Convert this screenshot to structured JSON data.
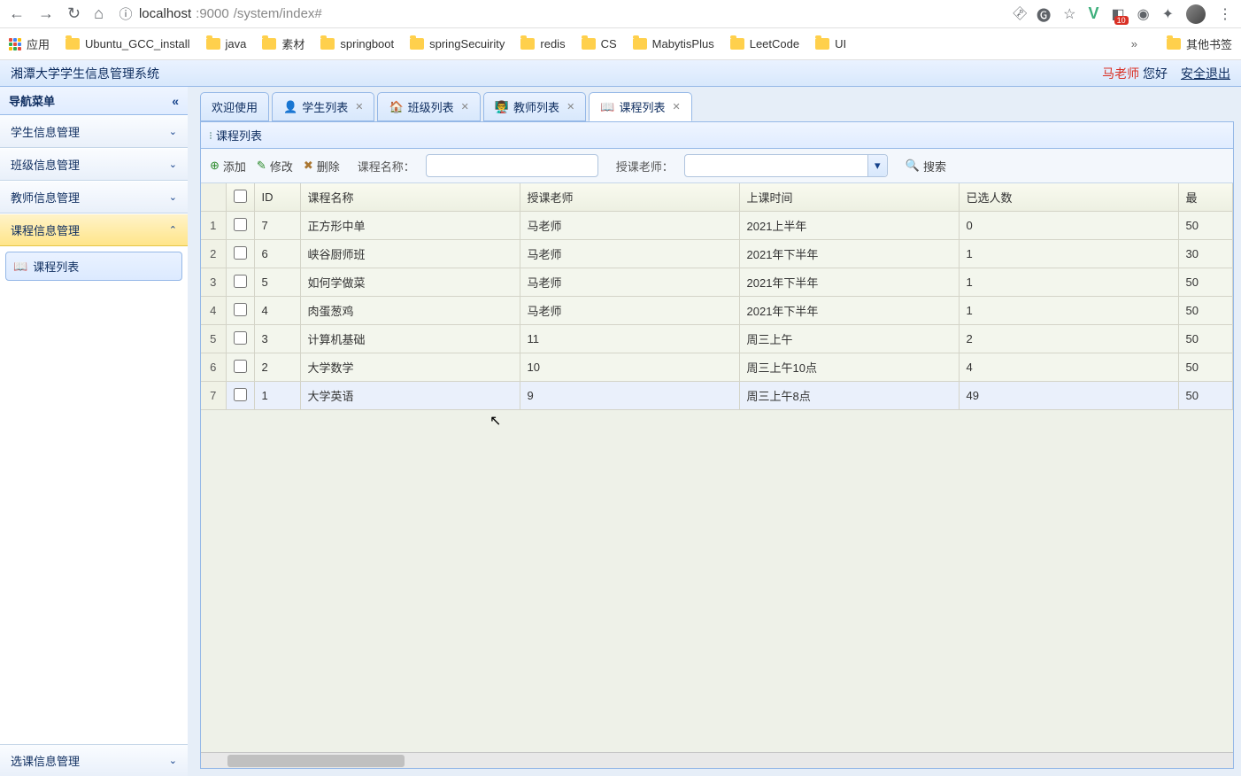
{
  "browser": {
    "url_host": "localhost",
    "url_port": ":9000",
    "url_path": "/system/index#",
    "badge": "10"
  },
  "bookmarks": {
    "apps": "应用",
    "items": [
      "Ubuntu_GCC_install",
      "java",
      "素材",
      "springboot",
      "springSecuirity",
      "redis",
      "CS",
      "MabytisPlus",
      "LeetCode",
      "UI"
    ],
    "more": "»",
    "other": "其他书签"
  },
  "header": {
    "title": "湘潭大学学生信息管理系统",
    "user": "马老师",
    "greet": "您好",
    "logout": "安全退出"
  },
  "sidebar": {
    "title": "导航菜单",
    "items": [
      {
        "label": "学生信息管理",
        "expanded": false
      },
      {
        "label": "班级信息管理",
        "expanded": false
      },
      {
        "label": "教师信息管理",
        "expanded": false
      },
      {
        "label": "课程信息管理",
        "expanded": true,
        "children": [
          {
            "label": "课程列表"
          }
        ]
      }
    ],
    "footer": "选课信息管理"
  },
  "tabs": [
    {
      "label": "欢迎使用",
      "closable": false,
      "icon": "none"
    },
    {
      "label": "学生列表",
      "closable": true,
      "icon": "student"
    },
    {
      "label": "班级列表",
      "closable": true,
      "icon": "home"
    },
    {
      "label": "教师列表",
      "closable": true,
      "icon": "teacher"
    },
    {
      "label": "课程列表",
      "closable": true,
      "icon": "book",
      "active": true
    }
  ],
  "panel": {
    "title": "课程列表"
  },
  "toolbar": {
    "add": "添加",
    "edit": "修改",
    "delete": "删除",
    "name_label": "课程名称：",
    "teacher_label": "授课老师：",
    "search": "搜索"
  },
  "grid": {
    "headers": [
      "ID",
      "课程名称",
      "授课老师",
      "上课时间",
      "已选人数",
      "最"
    ],
    "rows": [
      {
        "n": "1",
        "id": "7",
        "name": "正方形中单",
        "teacher": "马老师",
        "time": "2021上半年",
        "selected": "0",
        "max": "50"
      },
      {
        "n": "2",
        "id": "6",
        "name": "峡谷厨师班",
        "teacher": "马老师",
        "time": "2021年下半年",
        "selected": "1",
        "max": "30"
      },
      {
        "n": "3",
        "id": "5",
        "name": "如何学做菜",
        "teacher": "马老师",
        "time": "2021年下半年",
        "selected": "1",
        "max": "50"
      },
      {
        "n": "4",
        "id": "4",
        "name": "肉蛋葱鸡",
        "teacher": "马老师",
        "time": "2021年下半年",
        "selected": "1",
        "max": "50"
      },
      {
        "n": "5",
        "id": "3",
        "name": "计算机基础",
        "teacher": "11",
        "time": "周三上午",
        "selected": "2",
        "max": "50"
      },
      {
        "n": "6",
        "id": "2",
        "name": "大学数学",
        "teacher": "10",
        "time": "周三上午10点",
        "selected": "4",
        "max": "50"
      },
      {
        "n": "7",
        "id": "1",
        "name": "大学英语",
        "teacher": "9",
        "time": "周三上午8点",
        "selected": "49",
        "max": "50"
      }
    ]
  }
}
